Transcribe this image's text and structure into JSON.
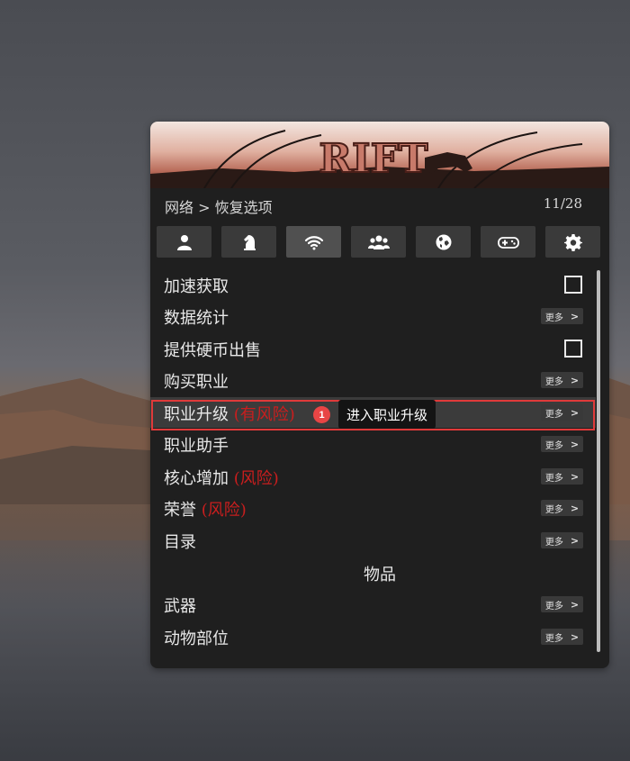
{
  "window": {
    "banner_logo": "RIFT"
  },
  "header": {
    "breadcrumb": "网络 > 恢复选项",
    "page_counter": "11/28"
  },
  "tabs": [
    {
      "icon": "user-icon",
      "active": false
    },
    {
      "icon": "chess-knight-icon",
      "active": false
    },
    {
      "icon": "wifi-icon",
      "active": true
    },
    {
      "icon": "users-icon",
      "active": false
    },
    {
      "icon": "globe-icon",
      "active": false
    },
    {
      "icon": "gamepad-icon",
      "active": false
    },
    {
      "icon": "gear-icon",
      "active": false
    }
  ],
  "menu": {
    "more_label": "更多",
    "more_chevron": ">",
    "items": [
      {
        "label": "加速获取",
        "risk": "",
        "control": "checkbox",
        "checked": false
      },
      {
        "label": "数据统计",
        "risk": "",
        "control": "more"
      },
      {
        "label": "提供硬币出售",
        "risk": "",
        "control": "checkbox",
        "checked": false
      },
      {
        "label": "购买职业",
        "risk": "",
        "control": "more"
      },
      {
        "label": "职业升级",
        "risk": "(有风险)",
        "control": "more",
        "highlighted": true
      },
      {
        "label": "职业助手",
        "risk": "",
        "control": "more"
      },
      {
        "label": "核心增加",
        "risk": "(风险)",
        "control": "more"
      },
      {
        "label": "荣誉",
        "risk": "(风险)",
        "control": "more"
      },
      {
        "label": "目录",
        "risk": "",
        "control": "more"
      }
    ],
    "section_title": "物品",
    "section_items": [
      {
        "label": "武器",
        "control": "more"
      },
      {
        "label": "动物部位",
        "control": "more"
      }
    ]
  },
  "annotation": {
    "step_number": "1",
    "tooltip_text": "进入职业升级",
    "highlight_color": "#e03a3a"
  },
  "colors": {
    "panel_bg": "#1f1f1f",
    "tab_bg": "#3a3a3a",
    "tab_active_bg": "#505050",
    "risk_text": "#c81e1e",
    "badge_bg": "#e84545"
  }
}
